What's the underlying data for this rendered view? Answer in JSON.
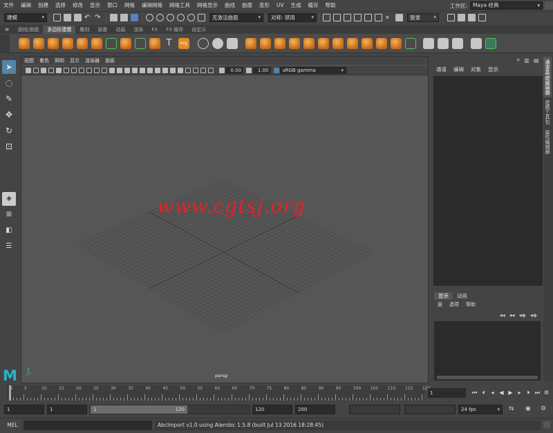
{
  "menubar": {
    "items": [
      "文件",
      "编辑",
      "创建",
      "选择",
      "修改",
      "显示",
      "窗口",
      "网格",
      "编辑网格",
      "网格工具",
      "网格显示",
      "曲线",
      "曲面",
      "变形",
      "UV",
      "生成",
      "缓存",
      "帮助"
    ]
  },
  "workspace": {
    "label": "工作区:",
    "value": "Maya 经典"
  },
  "statusline": {
    "mode": "建模",
    "live_surface": "无激活曲面",
    "symmetry": "对称: 禁用",
    "login": "登录"
  },
  "shelf": {
    "tabs": [
      "曲线/曲面",
      "多边形建模",
      "雕刻",
      "装备",
      "动画",
      "渲染",
      "FX",
      "FX 缓存",
      "自定义"
    ],
    "active_tab": "多边形建模",
    "text_button": "T",
    "svg_button": "svg"
  },
  "viewport": {
    "menu": [
      "视图",
      "着色",
      "照明",
      "显示",
      "渲染器",
      "面板"
    ],
    "exposure": "0.00",
    "gamma": "1.00",
    "color_space": "sRGB gamma",
    "camera": "persp",
    "watermark": "www.cgtsj.org"
  },
  "channelbox": {
    "menu": [
      "通道",
      "编辑",
      "对象",
      "显示"
    ]
  },
  "layerpanel": {
    "tabs": [
      "显示",
      "动画"
    ],
    "menu": [
      "层",
      "选项",
      "帮助"
    ]
  },
  "sidetabs": [
    "通道盒/层编辑器",
    "建模工具包",
    "属性编辑器"
  ],
  "timeslider": {
    "ticks": [
      1,
      5,
      10,
      15,
      20,
      25,
      30,
      35,
      40,
      45,
      50,
      55,
      60,
      65,
      70,
      75,
      80,
      85,
      90,
      95,
      100,
      105,
      110,
      115,
      120
    ],
    "current_frame": "1"
  },
  "rangeslider": {
    "start": "1",
    "playback_start": "1",
    "range_start_label": "1",
    "range_end_label": "120",
    "playback_end": "120",
    "end": "200",
    "fps": "24 fps"
  },
  "cmdline": {
    "mel_label": "MEL",
    "result": "AbcImport v1.0 using Alembic 1.5.8 (built Jul 13 2016 18:28:45)"
  },
  "logo": "M",
  "colors": {
    "accent": "#5285a6",
    "shelf_orange": "#e38b27",
    "watermark": "#e8202a",
    "maya_logo": "#23b5c8"
  }
}
